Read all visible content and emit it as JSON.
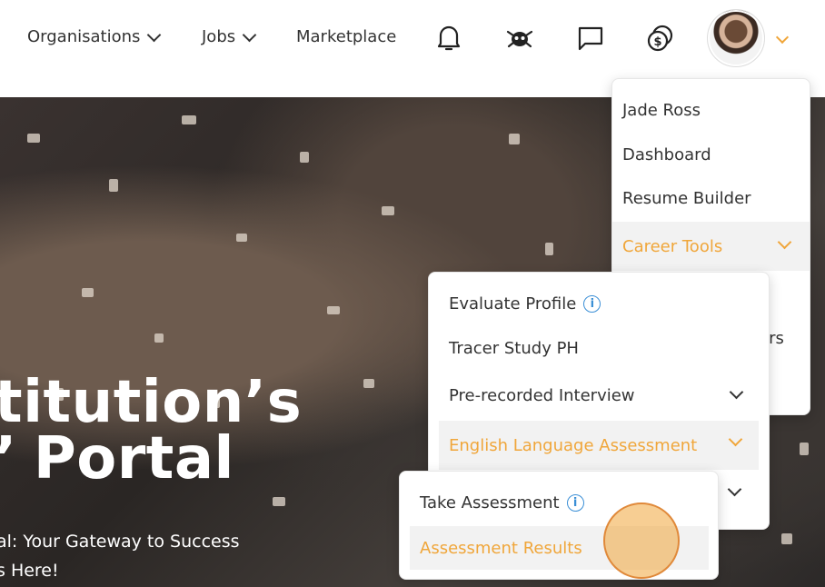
{
  "header": {
    "nav": [
      {
        "label": "Organisations",
        "has_dropdown": true
      },
      {
        "label": "Jobs",
        "has_dropdown": true
      },
      {
        "label": "Marketplace",
        "has_dropdown": false
      }
    ],
    "icons": [
      "bell-icon",
      "mascot-icon",
      "chat-icon",
      "coins-icon"
    ],
    "accent_color": "#f0a63a"
  },
  "hero": {
    "title_line1": "titution’s",
    "title_line2": "Portal",
    "title_prefix2": "’",
    "subtitle_line1": "al: Your Gateway to Success",
    "subtitle_line2": "s Here!"
  },
  "user_menu": {
    "items": [
      {
        "label": "Jade Ross"
      },
      {
        "label": "Dashboard"
      },
      {
        "label": "Resume Builder"
      },
      {
        "label": "Career Tools",
        "active": true
      }
    ],
    "partial_label": "tors"
  },
  "career_tools_menu": {
    "items": [
      {
        "label": "Evaluate Profile",
        "info": "i"
      },
      {
        "label": "Tracer Study PH"
      },
      {
        "label": "Pre-recorded Interview"
      },
      {
        "label": "English Language Assessment",
        "active": true
      }
    ]
  },
  "ela_menu": {
    "items": [
      {
        "label": "Take Assessment",
        "info": "i"
      },
      {
        "label": "Assessment Results",
        "active": true
      }
    ]
  }
}
